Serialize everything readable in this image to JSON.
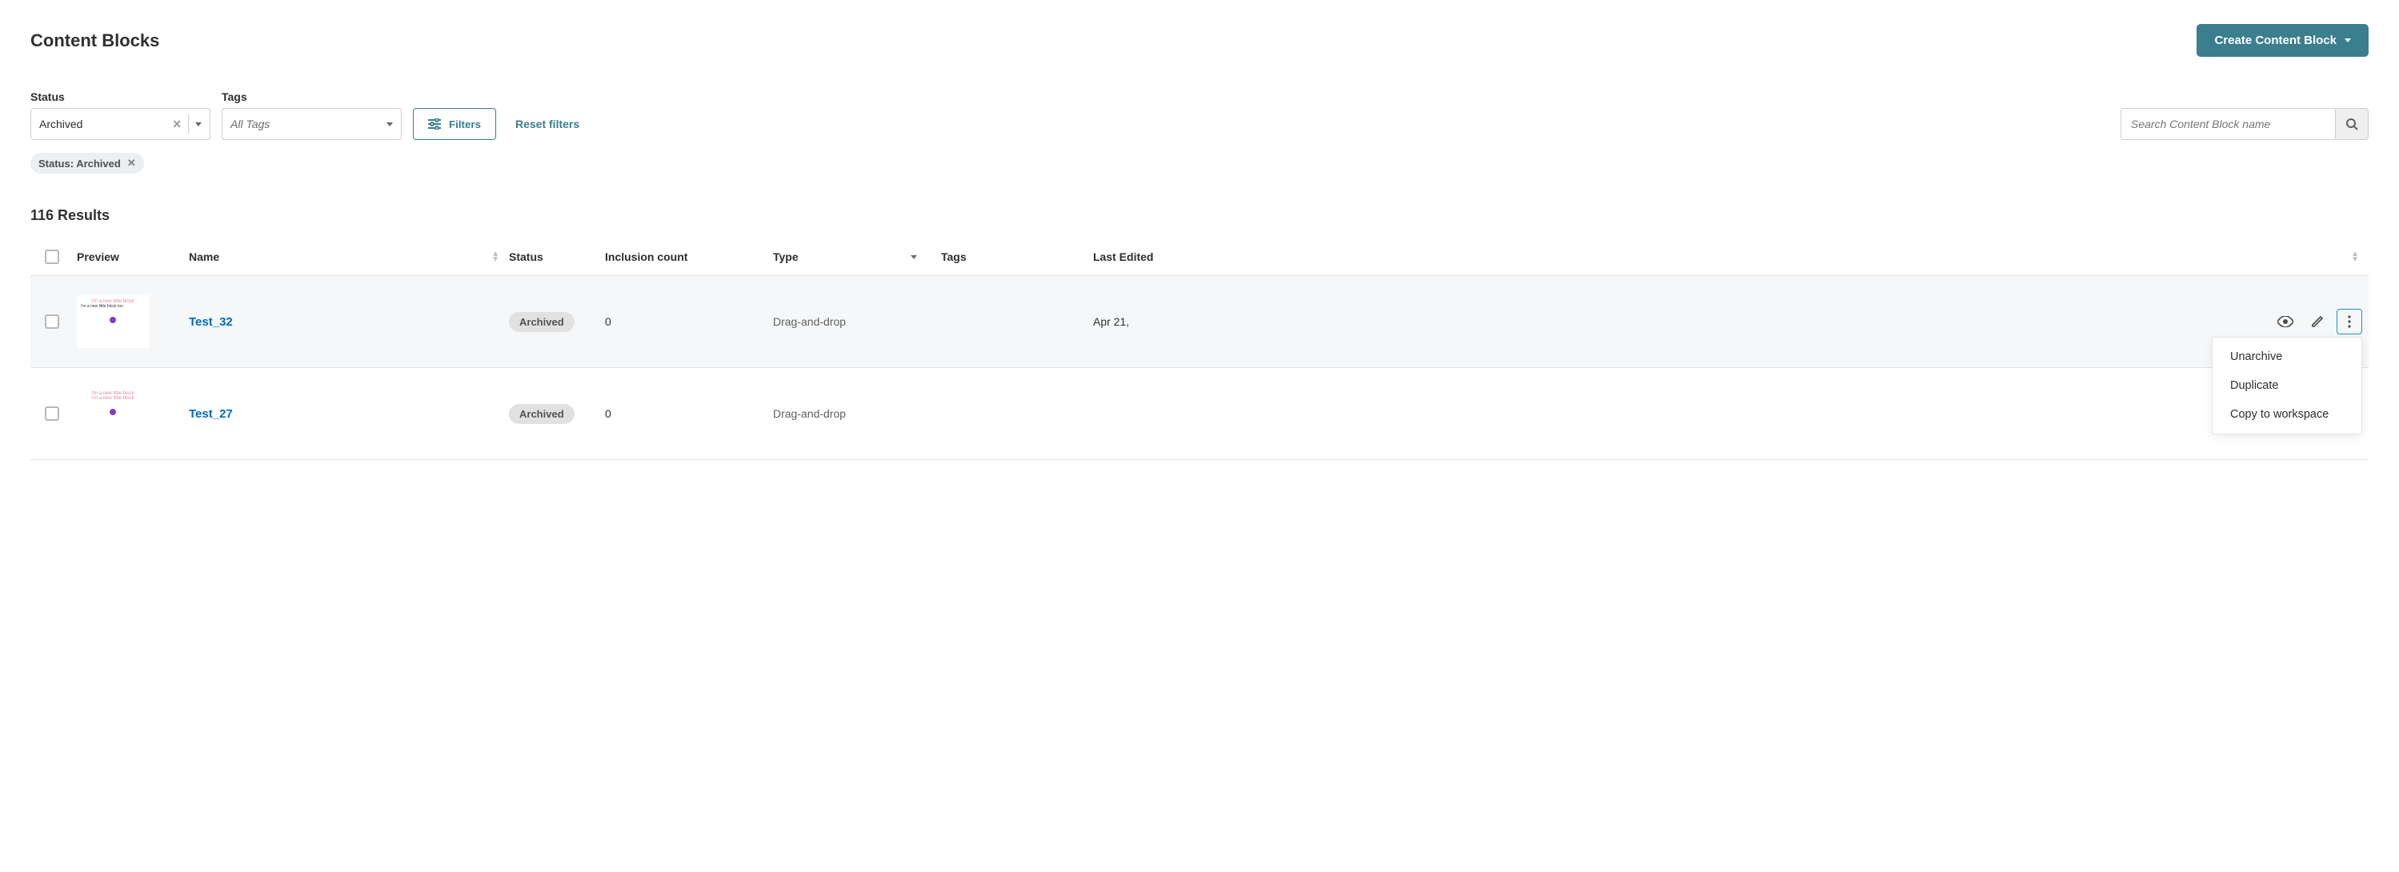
{
  "header": {
    "title": "Content Blocks",
    "create_label": "Create Content Block"
  },
  "filters": {
    "status_label": "Status",
    "status_value": "Archived",
    "tags_label": "Tags",
    "tags_value": "All Tags",
    "filters_btn": "Filters",
    "reset_btn": "Reset filters",
    "search_placeholder": "Search Content Block name"
  },
  "chip": {
    "text": "Status: Archived"
  },
  "results": {
    "count_text": "116 Results"
  },
  "columns": {
    "preview": "Preview",
    "name": "Name",
    "status": "Status",
    "inclusion": "Inclusion count",
    "type": "Type",
    "tags": "Tags",
    "last_edited": "Last Edited"
  },
  "rows": [
    {
      "name": "Test_32",
      "status": "Archived",
      "inclusion": "0",
      "type": "Drag-and-drop",
      "last_edited": "Apr 21,"
    },
    {
      "name": "Test_27",
      "status": "Archived",
      "inclusion": "0",
      "type": "Drag-and-drop",
      "last_edited": ""
    }
  ],
  "menu": {
    "unarchive": "Unarchive",
    "duplicate": "Duplicate",
    "copy": "Copy to workspace"
  }
}
